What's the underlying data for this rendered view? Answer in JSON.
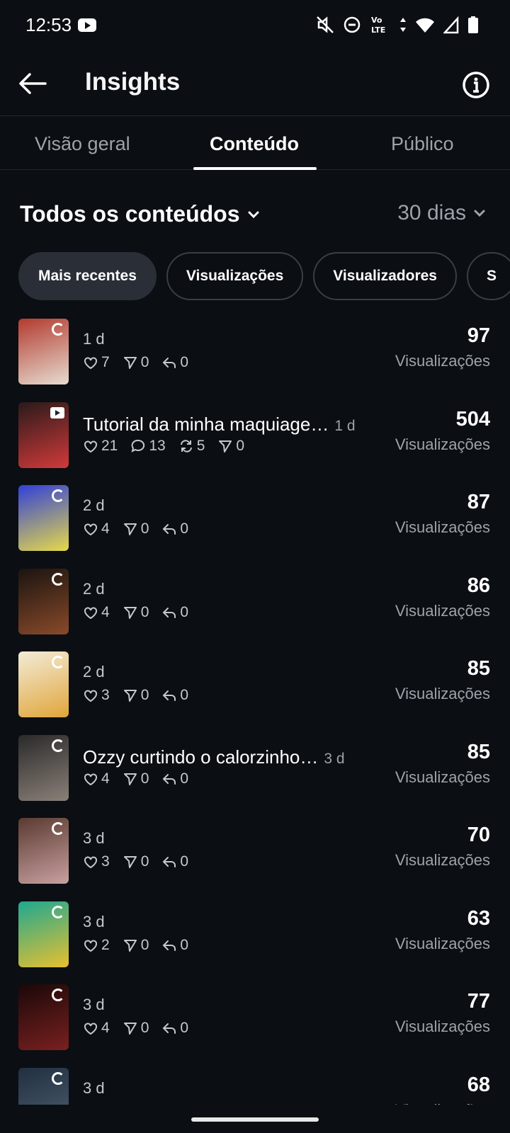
{
  "status_bar": {
    "time": "12:53",
    "icons": [
      "youtube-icon",
      "mute-icon",
      "do-not-disturb-icon",
      "volte-icon",
      "data-arrows-icon",
      "wifi-icon",
      "signal-icon",
      "battery-icon"
    ]
  },
  "header": {
    "title": "Insights",
    "back_icon": "arrow-left-icon",
    "info_icon": "info-icon"
  },
  "tabs": [
    {
      "label": "Visão geral",
      "active": false
    },
    {
      "label": "Conteúdo",
      "active": true
    },
    {
      "label": "Público",
      "active": false
    }
  ],
  "filters": {
    "content": "Todos os conteúdos",
    "range": "30 dias"
  },
  "chips": [
    {
      "label": "Mais recentes",
      "active": true
    },
    {
      "label": "Visualizações",
      "active": false
    },
    {
      "label": "Visualizadores",
      "active": false
    },
    {
      "label": "S",
      "active": false
    }
  ],
  "posts": [
    {
      "caption": "",
      "age": "1 d",
      "stats": [
        [
          "heart",
          "7"
        ],
        [
          "send",
          "0"
        ],
        [
          "reply",
          "0"
        ]
      ],
      "views": "97",
      "views_label": "Visualizações",
      "thumb_colors": [
        "#b33a2f",
        "#e7dcd0"
      ],
      "badge": "carousel"
    },
    {
      "caption": "Tutorial da minha maquiage…",
      "age": "1 d",
      "stats": [
        [
          "heart",
          "21"
        ],
        [
          "comment",
          "13"
        ],
        [
          "repost",
          "5"
        ],
        [
          "send",
          "0"
        ]
      ],
      "views": "504",
      "views_label": "Visualizações",
      "thumb_colors": [
        "#2a1a1a",
        "#d23a3a"
      ],
      "badge": "video"
    },
    {
      "caption": "",
      "age": "2 d",
      "stats": [
        [
          "heart",
          "4"
        ],
        [
          "send",
          "0"
        ],
        [
          "reply",
          "0"
        ]
      ],
      "views": "87",
      "views_label": "Visualizações",
      "thumb_colors": [
        "#3040d8",
        "#e6d94a"
      ],
      "badge": "carousel"
    },
    {
      "caption": "",
      "age": "2 d",
      "stats": [
        [
          "heart",
          "4"
        ],
        [
          "send",
          "0"
        ],
        [
          "reply",
          "0"
        ]
      ],
      "views": "86",
      "views_label": "Visualizações",
      "thumb_colors": [
        "#1a1410",
        "#8a4a2a"
      ],
      "badge": "carousel"
    },
    {
      "caption": "",
      "age": "2 d",
      "stats": [
        [
          "heart",
          "3"
        ],
        [
          "send",
          "0"
        ],
        [
          "reply",
          "0"
        ]
      ],
      "views": "85",
      "views_label": "Visualizações",
      "thumb_colors": [
        "#f3ecd8",
        "#e0a53a"
      ],
      "badge": "carousel"
    },
    {
      "caption": "Ozzy curtindo o calorzinho…",
      "age": "3 d",
      "stats": [
        [
          "heart",
          "4"
        ],
        [
          "send",
          "0"
        ],
        [
          "reply",
          "0"
        ]
      ],
      "views": "85",
      "views_label": "Visualizações",
      "thumb_colors": [
        "#2a2a2a",
        "#8a8078"
      ],
      "badge": "carousel"
    },
    {
      "caption": "",
      "age": "3 d",
      "stats": [
        [
          "heart",
          "3"
        ],
        [
          "send",
          "0"
        ],
        [
          "reply",
          "0"
        ]
      ],
      "views": "70",
      "views_label": "Visualizações",
      "thumb_colors": [
        "#5a3a30",
        "#c8a0a0"
      ],
      "badge": "carousel"
    },
    {
      "caption": "",
      "age": "3 d",
      "stats": [
        [
          "heart",
          "2"
        ],
        [
          "send",
          "0"
        ],
        [
          "reply",
          "0"
        ]
      ],
      "views": "63",
      "views_label": "Visualizações",
      "thumb_colors": [
        "#1fa890",
        "#e8c030"
      ],
      "badge": "carousel"
    },
    {
      "caption": "",
      "age": "3 d",
      "stats": [
        [
          "heart",
          "4"
        ],
        [
          "send",
          "0"
        ],
        [
          "reply",
          "0"
        ]
      ],
      "views": "77",
      "views_label": "Visualizações",
      "thumb_colors": [
        "#1a0808",
        "#7a2020"
      ],
      "badge": "carousel"
    },
    {
      "caption": "",
      "age": "3 d",
      "stats": [],
      "views": "68",
      "views_label": "Visualizações",
      "thumb_colors": [
        "#203040",
        "#506070"
      ],
      "badge": "carousel"
    }
  ]
}
